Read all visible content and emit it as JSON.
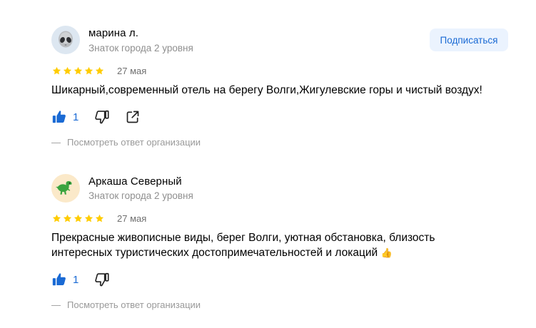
{
  "reviews": [
    {
      "author": "марина л.",
      "level": "Знаток города 2 уровня",
      "avatar_icon": "alien-icon",
      "subscribe_label": "Подписаться",
      "rating": 5,
      "date": "27 мая",
      "text": "Шикарный,современный отель на берегу Волги,Жигулевские горы и чистый воздух!",
      "likes": "1",
      "org_reply_label": "Посмотреть ответ организации"
    },
    {
      "author": "Аркаша Северный",
      "level": "Знаток города 2 уровня",
      "avatar_icon": "dinosaur-icon",
      "rating": 5,
      "date": "27 мая",
      "text": "Прекрасные живописные виды, берег Волги, уютная обстановка, близость интересных туристических достопримечательностей и локаций",
      "text_emoji": "👍",
      "likes": "1",
      "org_reply_label": "Посмотреть ответ организации"
    }
  ],
  "colors": {
    "star": "#fc0",
    "accent": "#1a6ad4",
    "subscribe_bg": "#ebf3fe",
    "muted": "#8f8f8f"
  },
  "dash": "—"
}
